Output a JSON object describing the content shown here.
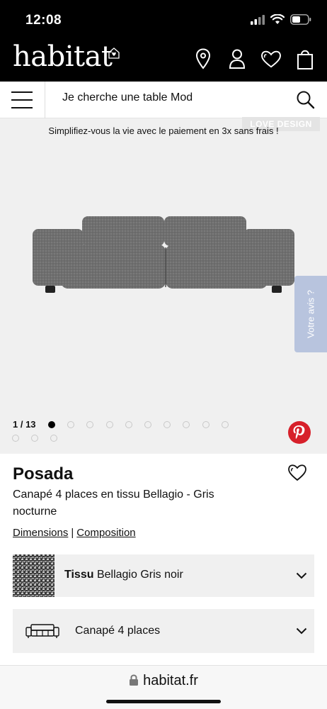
{
  "status": {
    "time": "12:08"
  },
  "header": {
    "logo": "habitat",
    "icons": [
      "location-pin-icon",
      "account-icon",
      "heart-icon",
      "shopping-bag-icon"
    ]
  },
  "search": {
    "value": "Je cherche une table Mod"
  },
  "gallery": {
    "ribbon": "LOVE DESIGN",
    "promo": "Simplifiez-vous la vie avec le paiement en 3x sans frais !",
    "counter": "1 / 13",
    "total_images": 13,
    "current_image": 1,
    "feedback": "Votre avis ?"
  },
  "product": {
    "name": "Posada",
    "description": "Canapé 4 places en tissu Bellagio - Gris nocturne",
    "link_dimensions": "Dimensions",
    "link_separator": "|",
    "link_composition": "Composition"
  },
  "options": {
    "fabric_prefix": "Tissu",
    "fabric_value": "Bellagio Gris noir",
    "size_label": "Canapé 4 places"
  },
  "browser": {
    "url": "habitat.fr"
  },
  "colors": {
    "header_bg": "#000000",
    "feedback_tab": "#b8c4de",
    "pinterest": "#d7202a",
    "option_bg": "#f0f0f0"
  }
}
